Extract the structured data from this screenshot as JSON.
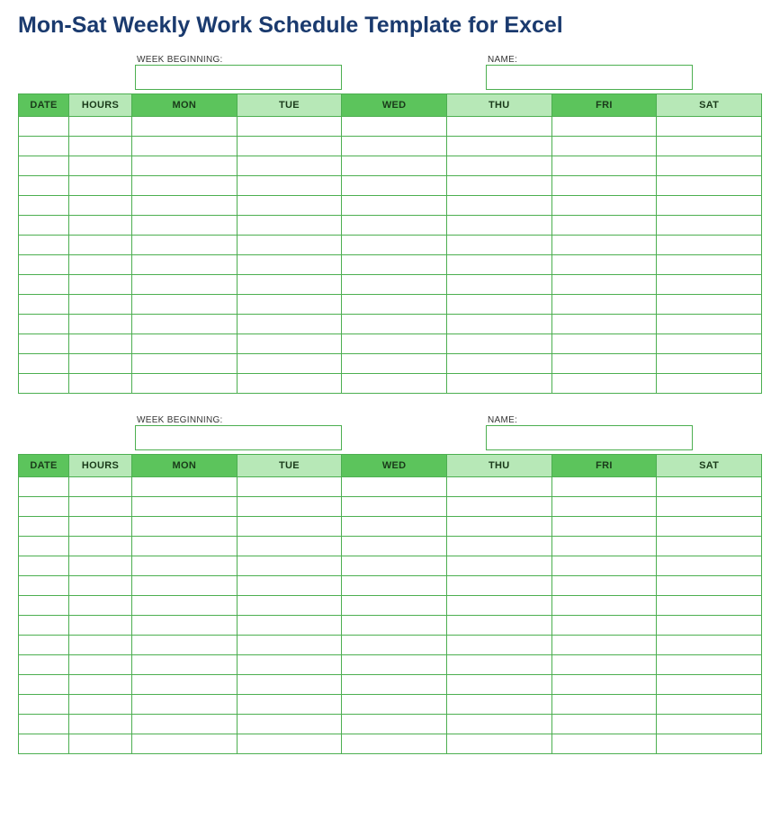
{
  "title": "Mon-Sat Weekly Work Schedule Template for Excel",
  "labels": {
    "week_beginning": "WEEK BEGINNING:",
    "name": "NAME:"
  },
  "headers": {
    "date": "DATE",
    "hours": "HOURS",
    "mon": "MON",
    "tue": "TUE",
    "wed": "WED",
    "thu": "THU",
    "fri": "FRI",
    "sat": "SAT"
  },
  "blocks": [
    {
      "week_beginning": "",
      "name": "",
      "rows": 14
    },
    {
      "week_beginning": "",
      "name": "",
      "rows": 14
    }
  ],
  "colors": {
    "title": "#1a3a6e",
    "border": "#4caf50",
    "header_dark": "#5cc45c",
    "header_light": "#b7e8b7"
  }
}
